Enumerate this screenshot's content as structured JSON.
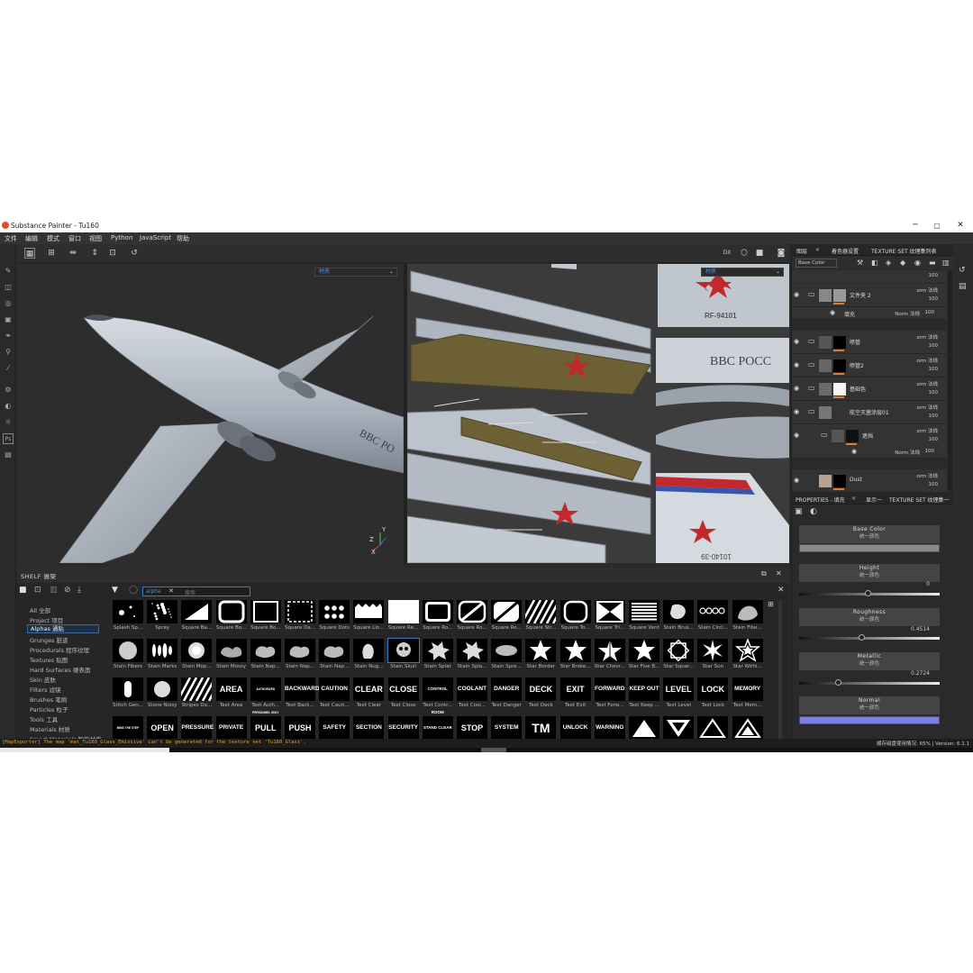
{
  "window": {
    "title": "Substance Painter - Tu160",
    "minimize": "─",
    "maximize": "▢",
    "close": "✕"
  },
  "menu": [
    "文件",
    "编辑",
    "模式",
    "窗口",
    "视图",
    "Python",
    "JavaScript",
    "帮助"
  ],
  "viewport": {
    "dropdown_3d": "材质",
    "dropdown_2d": "材质",
    "axis_x": "X",
    "axis_y": "Y",
    "axis_z": "Z"
  },
  "aircraft": {
    "registration": "RF-94101",
    "airline_text": "BBC POCC",
    "fuselage_text": "BBC PO",
    "tail_text": "10140-39"
  },
  "shelf": {
    "title": "SHELF 展架",
    "search_tag": "alpha",
    "search_placeholder": "搜索",
    "categories": [
      "All 全部",
      "Project 项目",
      "Alphas 通贴",
      "Grunges 脏迹",
      "Procedurals 程序纹理",
      "Textures 贴图",
      "Hard Surfaces 硬表面",
      "Skin 皮肤",
      "Filters 滤镜",
      "Brushes 笔刷",
      "Particles 粒子",
      "Tools 工具",
      "Materials 材质",
      "Smart Materials 智能材质"
    ],
    "row1_labels": [
      "Splash Sp...",
      "Spray",
      "Square Ba...",
      "Square Bo...",
      "Square Bo...",
      "Square Da...",
      "Square Dots",
      "Square Lin...",
      "Square Re...",
      "Square Ro...",
      "Square Ro...",
      "Square Ro...",
      "Square Str...",
      "Square To...",
      "Square Tri...",
      "Square Vent",
      "Stain Brus...",
      "Stain Circl...",
      "Stain Fibe..."
    ],
    "row2_labels": [
      "Stain Fibers",
      "Stain Marks",
      "Stain Mop...",
      "Stain Mossy",
      "Stain Nap...",
      "Stain Nap...",
      "Stain Nap...",
      "Stain Nug...",
      "Stain Skull",
      "Stain Splat",
      "Stain Spla...",
      "Stain Spre...",
      "Star Border",
      "Star Broke...",
      "Star Chevr...",
      "Star Five B...",
      "Star Squar...",
      "Star Sun",
      "Star Withi..."
    ],
    "row3_words": [
      "",
      "",
      "",
      "AREA",
      "AUTHORIZED PERSONNEL ONLY",
      "BACKWARD",
      "CAUTION",
      "CLEAR",
      "CLOSE",
      "CONTROL ROOM",
      "COOLANT",
      "DANGER",
      "DECK",
      "EXIT",
      "FORWARD",
      "KEEP OUT",
      "LEVEL",
      "LOCK",
      "MEMORY"
    ],
    "row3_labels": [
      "Stitch Gen...",
      "Stone Noisy",
      "Stripes Da...",
      "Text Area",
      "Text Auth...",
      "Text Back...",
      "Text Cauti...",
      "Text Clear",
      "Text Close",
      "Text Contr...",
      "Text Cool...",
      "Text Danger",
      "Text Deck",
      "Text Exit",
      "Text Forw...",
      "Text Keep ...",
      "Text Level",
      "Text Lock",
      "Text Mem..."
    ],
    "row4_words": [
      "MIND THE STEP",
      "OPEN",
      "PRESSURE",
      "PRIVATE",
      "PULL",
      "PUSH",
      "SAFETY",
      "SECTION",
      "SECURITY",
      "STAND CLEAR",
      "STOP",
      "SYSTEM",
      "TM",
      "UNLOCK",
      "WARNING",
      "",
      "",
      "",
      ""
    ]
  },
  "layers_panel": {
    "tabs": [
      "图层",
      "着色器设置",
      "TEXTURE SET 纹理集列表"
    ],
    "channel": "Base Color",
    "top_opacity": "100",
    "layers": [
      {
        "name": "文件夹 2",
        "mode": "orm 法线",
        "opacity": "100"
      },
      {
        "name": "填充",
        "mode": "Norm 法线",
        "opacity": "100"
      },
      {
        "name": "喷管",
        "mode": "orm 法线",
        "opacity": "100"
      },
      {
        "name": "喷管2",
        "mode": "orm 法线",
        "opacity": "100"
      },
      {
        "name": "基础色",
        "mode": "orm 法线",
        "opacity": "100"
      },
      {
        "name": "航空灭菌涂层01",
        "mode": "orm 法线",
        "opacity": "100"
      },
      {
        "name": "遮挡",
        "mode": "orm 法线",
        "opacity": "100"
      },
      {
        "name": "",
        "mode": "Norm 法线",
        "opacity": "100"
      },
      {
        "name": "Dust",
        "mode": "orm 法线",
        "opacity": "100"
      }
    ]
  },
  "properties_panel": {
    "tabs": [
      "PROPERTIES - 填充",
      "显示一",
      "TEXTURE SET 纹理集一"
    ],
    "base_color": {
      "name": "Base Color",
      "sub": "统一颜色"
    },
    "height": {
      "name": "Height",
      "sub": "统一颜色",
      "value": "0",
      "level": 0.5
    },
    "roughness": {
      "name": "Roughness",
      "sub": "统一颜色",
      "value": "0.4514",
      "level": 0.4514
    },
    "metallic": {
      "name": "Metallic",
      "sub": "统一颜色",
      "value": "0.2724",
      "level": 0.2724
    },
    "normal": {
      "name": "Normal",
      "sub": "统一颜色",
      "color": "#7d7ee8"
    }
  },
  "status": {
    "message": "[MapExporter] The map 'mat_Tu160_Glass_Emissive' can't be generated for the texture set 'Tu160_Glass'.",
    "cache": "缓存磁盘使用情况: 65% | Version: 6.1.1"
  },
  "colors": {
    "accent": "#3d78c0",
    "warning": "#e5a035",
    "star_red": "#c3282c",
    "orange_mark": "#e57a2c"
  }
}
